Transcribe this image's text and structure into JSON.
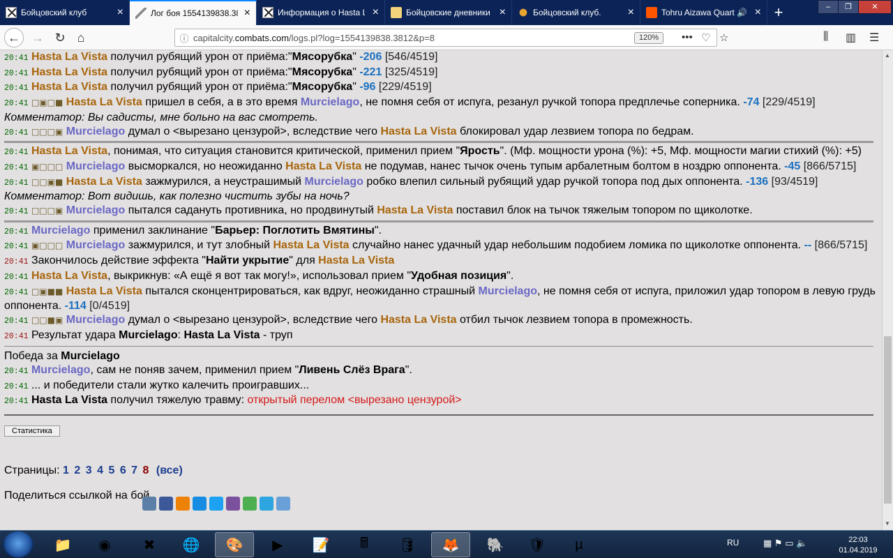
{
  "browser": {
    "tabs": [
      {
        "title": "Бойцовский клуб",
        "icon": "combats-x-icon",
        "active": false
      },
      {
        "title": "Лог боя 1554139838.38",
        "icon": "axe-icon",
        "active": true
      },
      {
        "title": "Информация о Hasta L",
        "icon": "combats-x-icon",
        "active": false
      },
      {
        "title": "Бойцовские дневники",
        "icon": "diary-icon",
        "active": false
      },
      {
        "title": "Бойцовский клуб.",
        "icon": "shield-icon",
        "active": false
      },
      {
        "title": "Tohru Aizawa Quart",
        "icon": "soundcloud-icon",
        "active": false
      }
    ],
    "url_prefix": "capitalcity.",
    "url_domain": "combats.com",
    "url_path": "/logs.pl?log=1554139838.3812&p=8",
    "zoom": "120%"
  },
  "log": {
    "stats_label": "Статистика",
    "pages_label": "Страницы:",
    "pages": [
      "1",
      "2",
      "3",
      "4",
      "5",
      "6",
      "7"
    ],
    "current_page": "8",
    "all_label": "(все)",
    "share_label": "Поделиться ссылкой на бой"
  },
  "taskbar": {
    "lang": "RU",
    "time": "22:03",
    "date": "01.04.2019"
  }
}
